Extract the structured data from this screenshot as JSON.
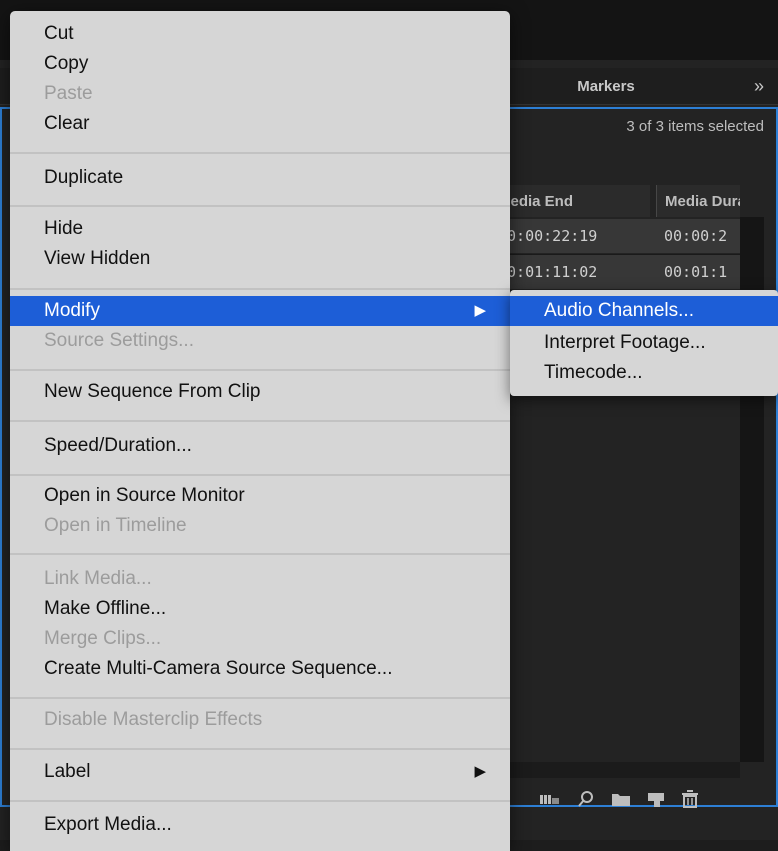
{
  "panel": {
    "tabs": [
      {
        "label": "Markers"
      }
    ],
    "overflow_label": "»",
    "selection_status": "3 of 3 items selected",
    "columns": [
      "Media End",
      "Media Dura"
    ],
    "rows": [
      {
        "media_end": "00:00:22:19",
        "media_duration": "00:00:2"
      },
      {
        "media_end": "00:01:11:02",
        "media_duration": "00:01:1"
      }
    ],
    "toolbar_icons": [
      "list-view-icon",
      "search-icon",
      "folder-icon",
      "new-item-icon",
      "trash-icon"
    ]
  },
  "context_menu": {
    "items": [
      {
        "label": "Cut",
        "enabled": true
      },
      {
        "label": "Copy",
        "enabled": true
      },
      {
        "label": "Paste",
        "enabled": false
      },
      {
        "label": "Clear",
        "enabled": true
      },
      {
        "label": "Duplicate",
        "enabled": true
      },
      {
        "label": "Hide",
        "enabled": true
      },
      {
        "label": "View Hidden",
        "enabled": true
      },
      {
        "label": "Modify",
        "enabled": true,
        "highlighted": true,
        "has_submenu": true
      },
      {
        "label": "Source Settings...",
        "enabled": false
      },
      {
        "label": "New Sequence From Clip",
        "enabled": true
      },
      {
        "label": "Speed/Duration...",
        "enabled": true
      },
      {
        "label": "Open in Source Monitor",
        "enabled": true
      },
      {
        "label": "Open in Timeline",
        "enabled": false
      },
      {
        "label": "Link Media...",
        "enabled": false
      },
      {
        "label": "Make Offline...",
        "enabled": true
      },
      {
        "label": "Merge Clips...",
        "enabled": false
      },
      {
        "label": "Create Multi-Camera Source Sequence...",
        "enabled": true
      },
      {
        "label": "Disable Masterclip Effects",
        "enabled": false
      },
      {
        "label": "Label",
        "enabled": true,
        "has_submenu": true
      },
      {
        "label": "Export Media...",
        "enabled": true
      }
    ],
    "submenu_arrow": "▶"
  },
  "submenu": {
    "items": [
      {
        "label": "Audio Channels...",
        "highlighted": true
      },
      {
        "label": "Interpret Footage..."
      },
      {
        "label": "Timecode..."
      }
    ]
  },
  "colors": {
    "highlight": "#1d5ed7",
    "menu_bg": "#d6d6d6",
    "panel_border": "#2d7fd5"
  }
}
